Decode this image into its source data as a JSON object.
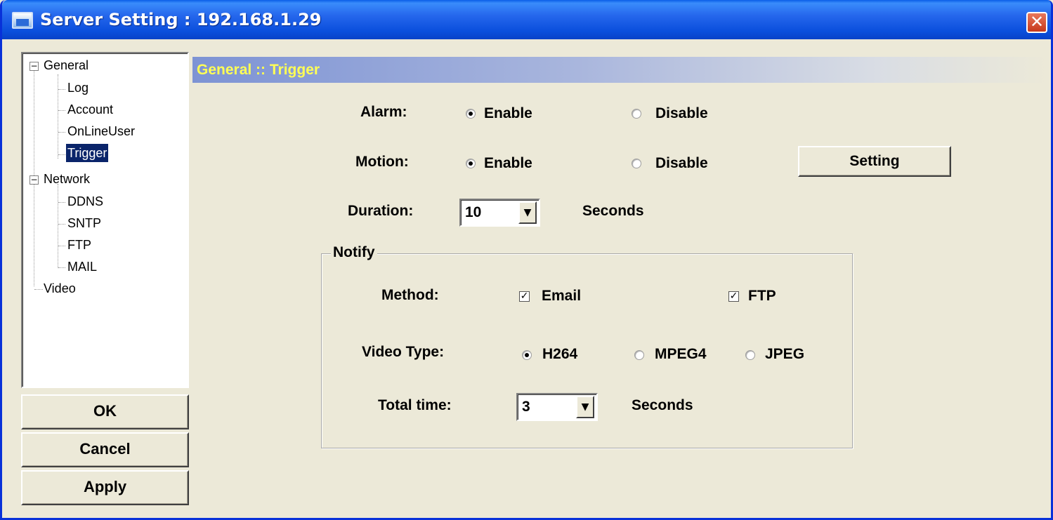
{
  "window": {
    "title": "Server Setting : 192.168.1.29",
    "close_glyph": "✕"
  },
  "tree": {
    "general": "General",
    "log": "Log",
    "account": "Account",
    "onlineuser": "OnLineUser",
    "trigger": "Trigger",
    "network": "Network",
    "ddns": "DDNS",
    "sntp": "SNTP",
    "ftp": "FTP",
    "mail": "MAIL",
    "video": "Video",
    "collapse_glyph": "−",
    "selected": "Trigger"
  },
  "buttons": {
    "ok": "OK",
    "cancel": "Cancel",
    "apply": "Apply",
    "setting": "Setting"
  },
  "section_header": "General :: Trigger",
  "alarm": {
    "label": "Alarm:",
    "enable": "Enable",
    "disable": "Disable",
    "selected": "Enable"
  },
  "motion": {
    "label": "Motion:",
    "enable": "Enable",
    "disable": "Disable",
    "selected": "Enable"
  },
  "duration": {
    "label": "Duration:",
    "value": "10",
    "unit": "Seconds"
  },
  "notify": {
    "title": "Notify",
    "method_label": "Method:",
    "email": "Email",
    "email_checked": true,
    "ftp": "FTP",
    "ftp_checked": true,
    "check_glyph": "✓",
    "video_type_label": "Video Type:",
    "h264": "H264",
    "mpeg4": "MPEG4",
    "jpeg": "JPEG",
    "video_type_selected": "H264",
    "total_time_label": "Total time:",
    "total_time_value": "3",
    "total_time_unit": "Seconds"
  },
  "icons": {
    "app": "app-icon",
    "close": "close-icon",
    "dropdown": "chevron-down-icon",
    "dropdown_glyph": "▼"
  }
}
